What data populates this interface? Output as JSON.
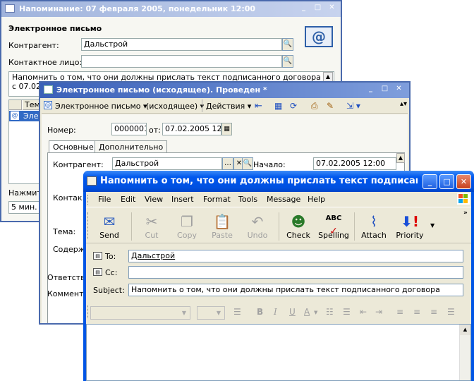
{
  "win1": {
    "title": "Напоминание: 07 февраля 2005, понедельник 12:00",
    "heading": "Электронное письмо",
    "kontragent_label": "Контрагент:",
    "kontragent_value": "Дальстрой",
    "contact_label": "Контактное лицо:",
    "contact_value": "",
    "text": "Напомнить о том, что они должны прислать текст подписанного договора",
    "text2": "с 07.02.",
    "table_header": "Тем",
    "table_row": "Элек",
    "press_label": "Нажмит",
    "snooze_value": "5 мин."
  },
  "win2": {
    "title": "Электронное письмо (исходящее). Проведен *",
    "toolbar": {
      "type_label": "Электронное письмо",
      "direction_label": "(исходящее)",
      "actions_label": "Действия"
    },
    "number_label": "Номер:",
    "number_value": "0000001",
    "from_label": "от:",
    "date_value": "07.02.2005 12:0",
    "tabs": [
      "Основные",
      "Дополнительно"
    ],
    "kontragent_label": "Контрагент:",
    "kontragent_value": "Дальстрой",
    "start_label": "Начало:",
    "start_value": "07.02.2005 12:00",
    "contact_label": "Контак.",
    "subject_label": "Тема:",
    "content_label": "Содержа",
    "responsible_label": "Ответстве",
    "comment_label": "Коммента"
  },
  "win3": {
    "title": "Напомнить о том, что они должны прислать текст подписанного догово...",
    "menu": [
      "File",
      "Edit",
      "View",
      "Insert",
      "Format",
      "Tools",
      "Message",
      "Help"
    ],
    "toolbar": {
      "send": "Send",
      "cut": "Cut",
      "copy": "Copy",
      "paste": "Paste",
      "undo": "Undo",
      "check": "Check",
      "spelling": "Spelling",
      "attach": "Attach",
      "priority": "Priority"
    },
    "to_label": "To:",
    "to_value": "Дальстрой",
    "cc_label": "Cc:",
    "cc_value": "",
    "subject_label": "Subject:",
    "subject_value": "Напомнить о том, что они должны прислать текст подписанного договора",
    "format": {
      "bold": "B",
      "italic": "I",
      "underline": "U",
      "color": "A"
    }
  }
}
